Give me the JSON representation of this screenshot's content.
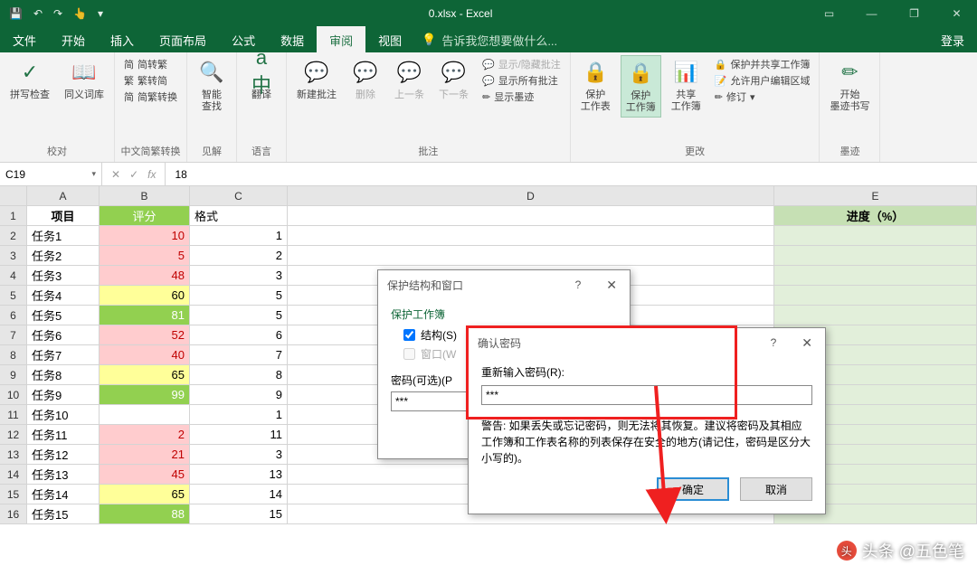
{
  "title": "0.xlsx - Excel",
  "menu": {
    "file": "文件",
    "home": "开始",
    "insert": "插入",
    "layout": "页面布局",
    "formula": "公式",
    "data": "数据",
    "review": "审阅",
    "view": "视图",
    "tellme": "告诉我您想要做什么...",
    "login": "登录"
  },
  "ribbon": {
    "proofing": {
      "spell": "拼写检查",
      "thesaurus": "同义词库",
      "label": "校对"
    },
    "chinese": {
      "s2t": "简转繁",
      "t2s": "繁转简",
      "convert": "简繁转换",
      "label": "中文简繁转换"
    },
    "insights": {
      "smart": "智能\n查找",
      "label": "见解"
    },
    "language": {
      "translate": "翻译",
      "label": "语言"
    },
    "comments": {
      "new": "新建批注",
      "delete": "删除",
      "prev": "上一条",
      "next": "下一条",
      "showhide": "显示/隐藏批注",
      "showall": "显示所有批注",
      "ink": "显示墨迹",
      "label": "批注"
    },
    "changes": {
      "protectSheet": "保护\n工作表",
      "protectBook": "保护\n工作簿",
      "share": "共享\n工作簿",
      "protectShare": "保护并共享工作簿",
      "allowEdit": "允许用户编辑区域",
      "track": "修订",
      "label": "更改"
    },
    "ink": {
      "start": "开始\n墨迹书写",
      "label": "墨迹"
    }
  },
  "formula_bar": {
    "name": "C19",
    "fx": "fx",
    "value": "18"
  },
  "columns": [
    "A",
    "B",
    "C",
    "D",
    "E"
  ],
  "header_row": {
    "a": "项目",
    "b": "评分",
    "c": "格式",
    "e": "进度（%）"
  },
  "rows": [
    {
      "n": 1
    },
    {
      "n": 2,
      "a": "任务1",
      "b": 10,
      "c": 1,
      "bcls": "bg-pink fg-red"
    },
    {
      "n": 3,
      "a": "任务2",
      "b": 5,
      "c": 2,
      "bcls": "bg-pink fg-red"
    },
    {
      "n": 4,
      "a": "任务3",
      "b": 48,
      "c": 3,
      "bcls": "bg-pink fg-red"
    },
    {
      "n": 5,
      "a": "任务4",
      "b": 60,
      "c": 5,
      "bcls": "bg-yellow"
    },
    {
      "n": 6,
      "a": "任务5",
      "b": 81,
      "c": 5,
      "bcls": "bg-green"
    },
    {
      "n": 7,
      "a": "任务6",
      "b": 52,
      "c": 6,
      "bcls": "bg-pink fg-red"
    },
    {
      "n": 8,
      "a": "任务7",
      "b": 40,
      "c": 7,
      "bcls": "bg-pink fg-red"
    },
    {
      "n": 9,
      "a": "任务8",
      "b": 65,
      "c": 8,
      "bcls": "bg-yellow"
    },
    {
      "n": 10,
      "a": "任务9",
      "b": 99,
      "c": 9,
      "bcls": "bg-green"
    },
    {
      "n": 11,
      "a": "任务10",
      "b": "",
      "c": 1,
      "bcls": ""
    },
    {
      "n": 12,
      "a": "任务11",
      "b": 2,
      "c": 11,
      "bcls": "bg-pink fg-red"
    },
    {
      "n": 13,
      "a": "任务12",
      "b": 21,
      "c": 3,
      "bcls": "bg-pink fg-red"
    },
    {
      "n": 14,
      "a": "任务13",
      "b": 45,
      "c": 13,
      "bcls": "bg-pink fg-red"
    },
    {
      "n": 15,
      "a": "任务14",
      "b": 65,
      "c": 14,
      "bcls": "bg-yellow"
    },
    {
      "n": 16,
      "a": "任务15",
      "b": 88,
      "c": 15,
      "bcls": "bg-green"
    }
  ],
  "dialog1": {
    "title": "保护结构和窗口",
    "group": "保护工作簿",
    "structure": "结构(S)",
    "window": "窗口(W",
    "password_label": "密码(可选)(P",
    "password_value": "***"
  },
  "dialog2": {
    "title": "确认密码",
    "reenter": "重新输入密码(R):",
    "value": "***",
    "warning": "警告: 如果丢失或忘记密码，则无法将其恢复。建议将密码及其相应工作簿和工作表名称的列表保存在安全的地方(请记住，密码是区分大小写的)。",
    "ok": "确定",
    "cancel": "取消"
  },
  "watermark": "头条 @五色笔"
}
